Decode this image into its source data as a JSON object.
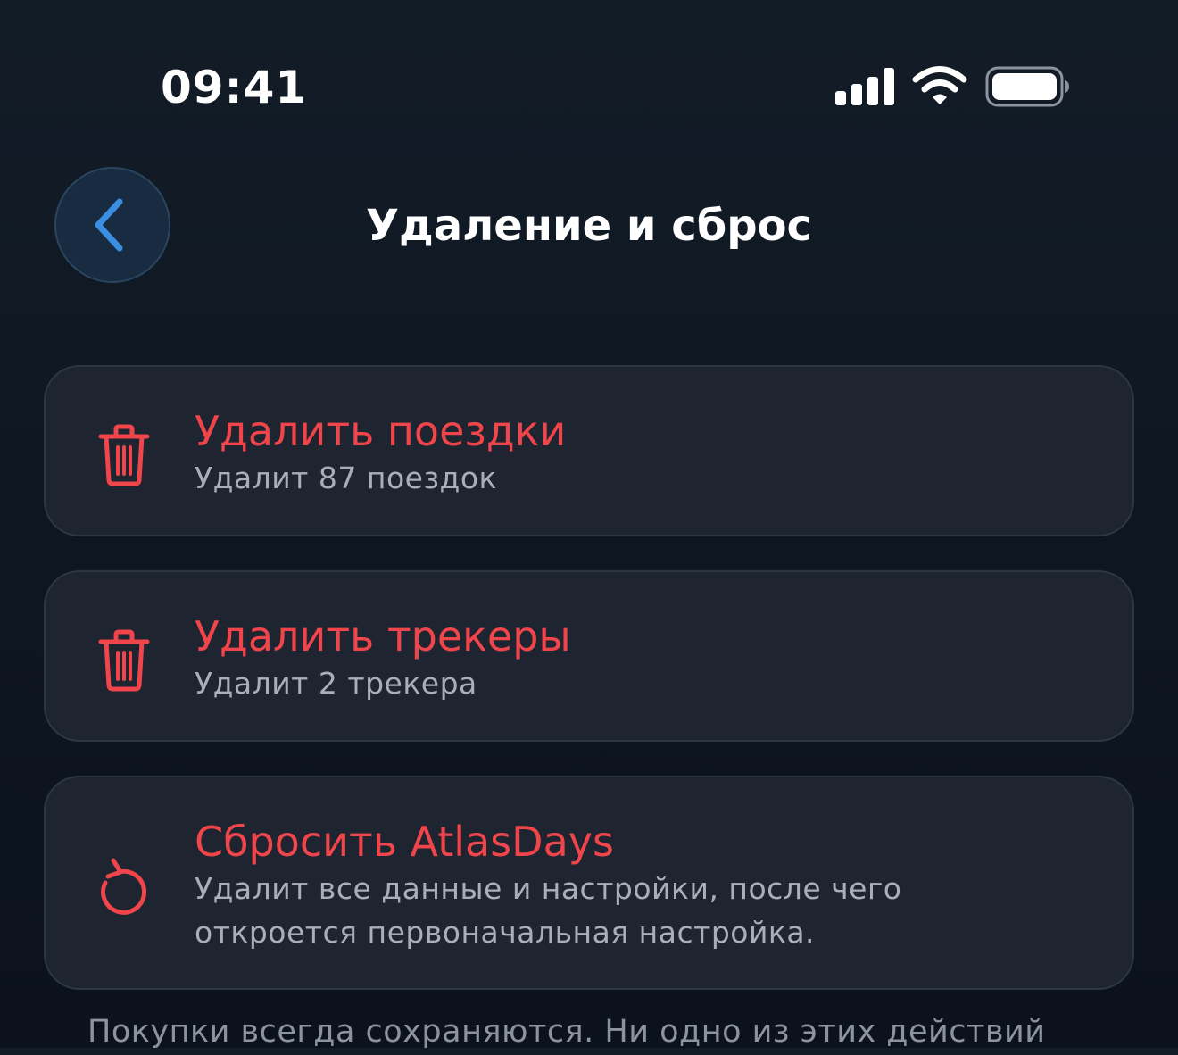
{
  "status_bar": {
    "time": "09:41",
    "signal_icon": "cellular-signal-icon",
    "wifi_icon": "wifi-icon",
    "battery_icon": "battery-icon"
  },
  "header": {
    "back_icon": "chevron-left-icon",
    "title": "Удаление и сброс"
  },
  "actions": [
    {
      "icon": "trash-icon",
      "title": "Удалить поездки",
      "subtitle": "Удалит 87 поездок"
    },
    {
      "icon": "trash-icon",
      "title": "Удалить трекеры",
      "subtitle": "Удалит 2 трекера"
    },
    {
      "icon": "reset-arrow-icon",
      "title": "Сбросить AtlasDays",
      "subtitle": "Удалит все данные и настройки, после чего откроется первоначальная настройка."
    }
  ],
  "footer": {
    "note": "Покупки всегда сохраняются. Ни одно из этих действий"
  },
  "colors": {
    "background": "#0f1722",
    "card": "#1e2430",
    "destructive": "#f0454a",
    "accent": "#3b8fe0",
    "secondary_text": "#a9afb9"
  }
}
